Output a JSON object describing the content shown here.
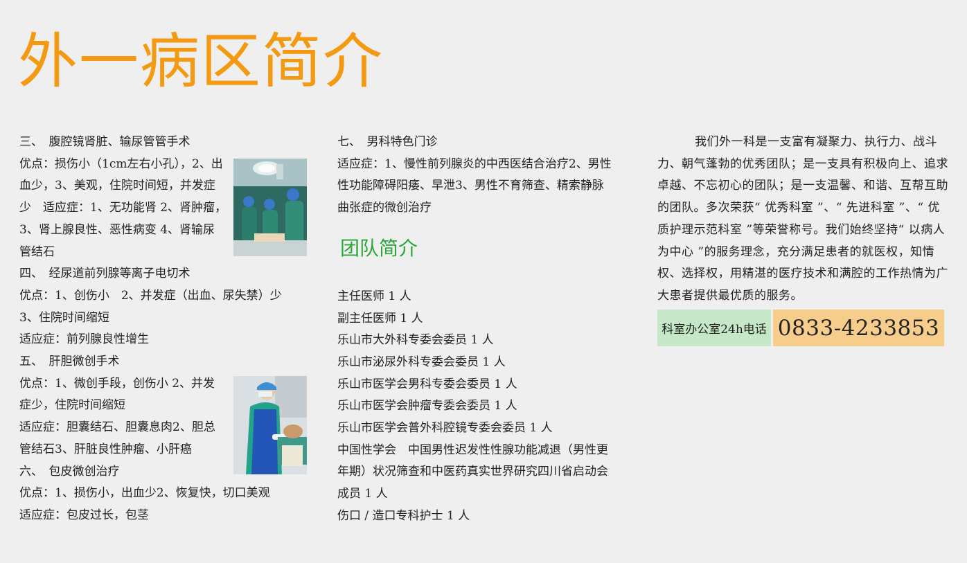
{
  "title": "外一病区简介",
  "left": {
    "lines": [
      "三、　腹腔镜肾脏、输尿管管手术",
      "优点：损伤小（1cm左右小孔），2、出",
      "血少，3、美观，住院时间短，并发症",
      "少　适应症：1、无功能肾 2、肾肿瘤，",
      "3、肾上腺良性、恶性病变 4、肾输尿",
      "管结石",
      "四、　经尿道前列腺等离子电切术",
      "优点：1、创伤小　2、并发症（出血、尿失禁）少",
      "3、住院时间缩短",
      "适应症：前列腺良性增生",
      "五、　肝胆微创手术",
      "优点：1、微创手段，创伤小 2、并发",
      "症少，住院时间缩短",
      "适应症：胆囊结石、胆囊息肉2、胆总",
      "管结石3、肝脏良性肿瘤、小肝癌",
      "六、　包皮微创治疗",
      "优点：1、损伤小，出血少2、恢复快，切口美观",
      "适应症：包皮过长，包茎"
    ]
  },
  "middle": {
    "lines": [
      "七、　男科特色门诊",
      "适应症：1、慢性前列腺炎的中西医结合治疗2、男性",
      "性功能障碍阳痿、早泄3、男性不育筛查、精索静脉",
      "曲张症的微创治疗"
    ],
    "team_heading": "团队简介",
    "team": [
      "主任医师 1 人",
      "副主任医师 1 人",
      "乐山市大外科专委会委员 1 人",
      "乐山市泌尿外科专委会委员 1 人",
      "乐山市医学会男科专委会委员 1 人",
      "乐山市医学会肿瘤专委会委员 1 人",
      "乐山市医学会普外科腔镜专委会委员 1 人",
      "中国性学会　中国男性迟发性性腺功能减退（男性更",
      "年期）状况筛查和中医药真实世界研究四川省启动会",
      "成员 1 人",
      "伤口 / 造口专科护士 1 人"
    ]
  },
  "right": {
    "intro": "我们外一科是一支富有凝聚力、执行力、战斗力、朝气蓬勃的优秀团队；是一支具有积极向上、追求卓越、不忘初心的团队；是一支温馨、和谐、互帮互助的团队。多次荣获“ 优秀科室 ”、“ 先进科室 ”、“ 优质护理示范科室 ”等荣誉称号。我们始终坚持“ 以病人为中心 ”的服务理念，充分满足患者的就医权，知情权、选择权，用精湛的医疗技术和满腔的工作热情为广大患者提供最优质的服务。",
    "phone_label": "科室办公室24h电话",
    "phone_number": "0833-4233853"
  },
  "colors": {
    "title": "#f39a12",
    "team_heading": "#2aa63a",
    "phone_label_bg": "#c6e8c9",
    "phone_number_bg": "#f7cd8c"
  }
}
